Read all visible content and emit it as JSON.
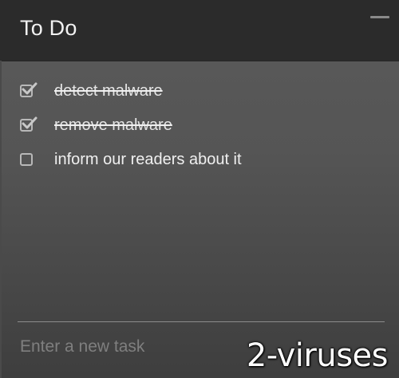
{
  "header": {
    "title": "To Do"
  },
  "tasks": [
    {
      "label": "detect malware",
      "done": true
    },
    {
      "label": "remove malware",
      "done": true
    },
    {
      "label": "inform our readers about it",
      "done": false
    }
  ],
  "new_task": {
    "placeholder": "Enter a new task",
    "value": ""
  },
  "watermark": {
    "text": "2-viruses"
  },
  "icons": {
    "minimize": "minimize-icon",
    "check": "checkmark-icon"
  },
  "colors": {
    "header_bg": "#2b2b2b",
    "body_bg": "#555555",
    "text": "#f0f0f0",
    "placeholder": "#7f7f7f"
  }
}
